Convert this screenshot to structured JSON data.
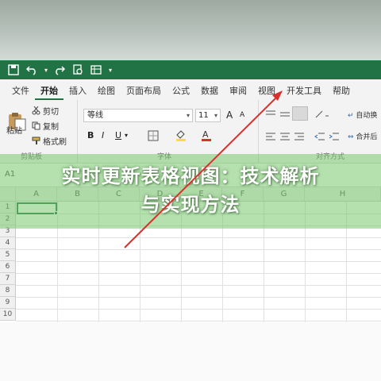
{
  "quick_access": {
    "dropdown_glyph": "▾",
    "more_glyph": "▾"
  },
  "tabs": [
    {
      "label": "文件",
      "active": false
    },
    {
      "label": "开始",
      "active": true
    },
    {
      "label": "插入",
      "active": false
    },
    {
      "label": "绘图",
      "active": false
    },
    {
      "label": "页面布局",
      "active": false
    },
    {
      "label": "公式",
      "active": false
    },
    {
      "label": "数据",
      "active": false
    },
    {
      "label": "审阅",
      "active": false
    },
    {
      "label": "视图",
      "active": false
    },
    {
      "label": "开发工具",
      "active": false
    },
    {
      "label": "帮助",
      "active": false
    }
  ],
  "ribbon": {
    "clipboard": {
      "paste_label": "粘贴",
      "cut_label": "剪切",
      "copy_label": "复制",
      "format_painter_label": "格式刷",
      "group_label": "剪贴板"
    },
    "font": {
      "font_name": "等线",
      "font_size": "11",
      "bold": "B",
      "italic": "I",
      "underline": "U",
      "grow": "A",
      "shrink": "A",
      "group_label": "字体"
    },
    "alignment": {
      "wrap_label": "自动换",
      "merge_label": "合并后",
      "group_label": "对齐方式"
    }
  },
  "formula_bar": {
    "name_box": "A1"
  },
  "sheet": {
    "columns": [
      "A",
      "B",
      "C",
      "D",
      "E",
      "F",
      "G",
      "H"
    ],
    "rows": [
      "1",
      "2",
      "3",
      "4",
      "5",
      "6",
      "7",
      "8",
      "9",
      "10"
    ],
    "selected_cell": "A1"
  },
  "overlay": {
    "title_line1": "实时更新表格视图：技术解析",
    "title_line2": "与实现方法"
  },
  "colors": {
    "excel_green": "#217346",
    "arrow_red": "#d9302c",
    "band": "#78c86e"
  }
}
